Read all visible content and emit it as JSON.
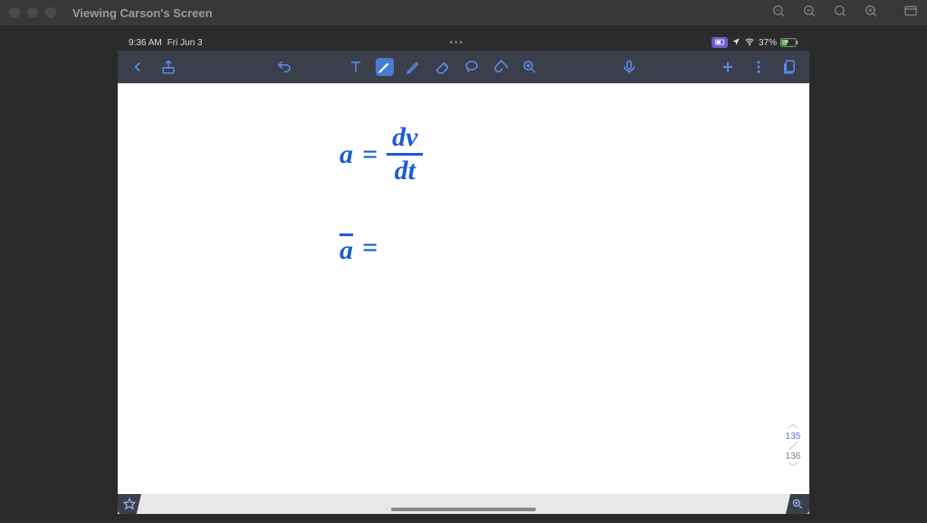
{
  "mac": {
    "title": "Viewing Carson's Screen"
  },
  "statusbar": {
    "time": "9:36 AM",
    "date": "Fri Jun 3",
    "battery_pct": "37%"
  },
  "canvas": {
    "equation1": {
      "lhs": "a",
      "eq": "=",
      "num": "dv",
      "den": "dt"
    },
    "equation2": {
      "lhs": "a",
      "eq": "="
    }
  },
  "pages": {
    "current": "135",
    "total": "136"
  },
  "colors": {
    "ink": "#1e5bd6",
    "toolbar": "#3a3f4b",
    "accent": "#5b8def"
  }
}
